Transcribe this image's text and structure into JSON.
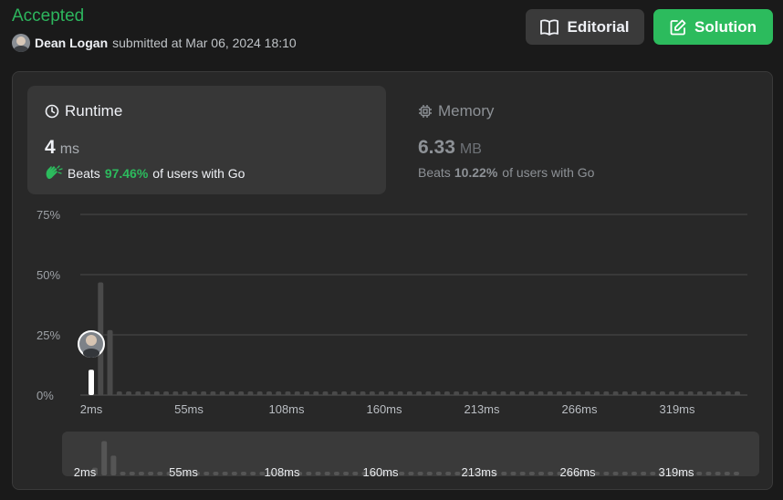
{
  "header": {
    "status": "Accepted",
    "username": "Dean Logan",
    "submitted_text": "submitted at Mar 06, 2024 18:10",
    "editorial_label": "Editorial",
    "solution_label": "Solution"
  },
  "runtime": {
    "label": "Runtime",
    "value": "4",
    "unit": "ms",
    "beats_prefix": "Beats",
    "beats_pct": "97.46%",
    "beats_suffix": "of users with Go"
  },
  "memory": {
    "label": "Memory",
    "value": "6.33",
    "unit": "MB",
    "beats_prefix": "Beats",
    "beats_pct": "10.22%",
    "beats_suffix": "of users with Go"
  },
  "colors": {
    "accepted": "#2db55d",
    "accent": "#2cbb5d",
    "bar": "#4a4a4a",
    "highlight": "#ffffff"
  },
  "chart_data": {
    "type": "bar",
    "ylabel": "",
    "xlabel": "",
    "ylim": [
      0,
      75
    ],
    "y_ticks": [
      "0%",
      "25%",
      "50%",
      "75%"
    ],
    "y_tick_values": [
      0,
      25,
      50,
      75
    ],
    "x_tick_labels": [
      "2ms",
      "55ms",
      "108ms",
      "160ms",
      "213ms",
      "266ms",
      "319ms"
    ],
    "values": [
      10.5,
      46.8,
      27.0,
      1.5,
      1.5,
      1.5,
      1.5,
      1.5,
      1.5,
      1.5,
      1.5,
      1.5,
      1.5,
      1.5,
      1.5,
      1.5,
      1.5,
      1.5,
      1.5,
      1.5,
      1.5,
      1.5,
      1.5,
      1.5,
      1.5,
      1.5,
      1.5,
      1.5,
      1.5,
      1.5,
      1.5,
      1.5,
      1.5,
      1.5,
      1.5,
      1.5,
      1.5,
      1.5,
      1.5,
      1.5,
      1.5,
      1.5,
      1.5,
      1.5,
      1.5,
      1.5,
      1.5,
      1.5,
      1.5,
      1.5,
      1.5,
      1.5,
      1.5,
      1.5,
      1.5,
      1.5,
      1.5,
      1.5,
      1.5,
      1.5,
      1.5,
      1.5,
      1.5,
      1.5,
      1.5,
      1.5,
      1.5,
      1.5,
      1.5,
      1.5
    ],
    "highlight_index": 0,
    "grid": true
  }
}
